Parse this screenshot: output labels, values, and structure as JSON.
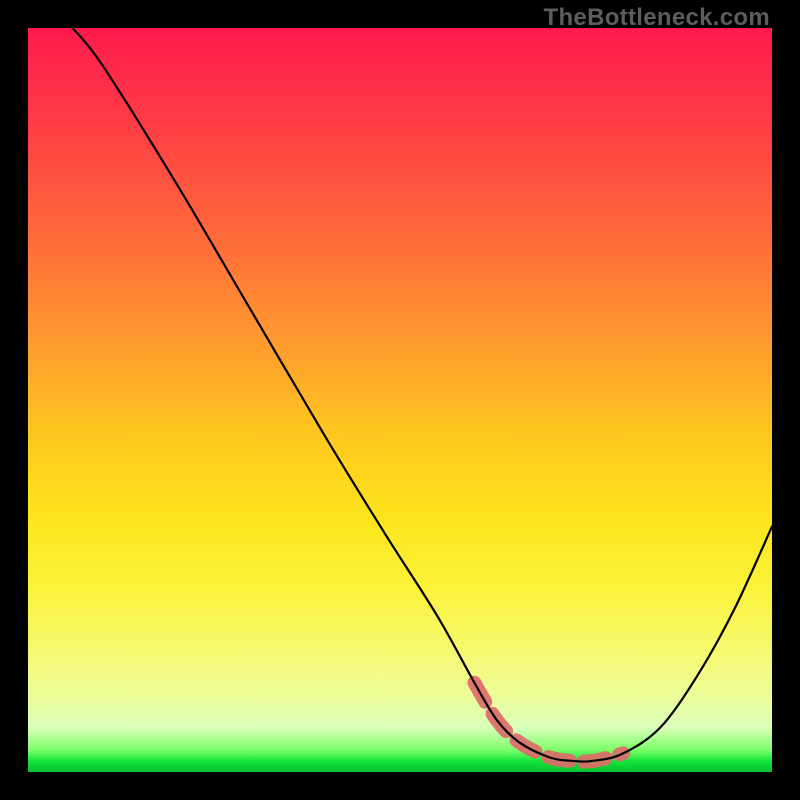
{
  "watermark": {
    "text": "TheBottleneck.com"
  },
  "chart_data": {
    "type": "line",
    "title": "",
    "xlabel": "",
    "ylabel": "",
    "xlim": [
      0,
      100
    ],
    "ylim": [
      0,
      100
    ],
    "grid": false,
    "legend": false,
    "series": [
      {
        "name": "curve",
        "x": [
          6,
          10,
          20,
          30,
          40,
          48,
          55,
          60,
          63,
          66,
          70,
          73,
          76,
          80,
          85,
          90,
          95,
          100
        ],
        "y": [
          100,
          95,
          79,
          62,
          45,
          32,
          21,
          12,
          7,
          4,
          2,
          1.5,
          1.5,
          2.5,
          6,
          13,
          22,
          33
        ]
      }
    ],
    "annotations": {
      "valley_band": {
        "description": "slightly thicker salmon-colored segment along valley bottom",
        "x_range": [
          60,
          81
        ],
        "y_approx": 2
      }
    }
  },
  "colors": {
    "curve_stroke": "#000000",
    "valley_band": "#de6b6b",
    "background_top": "#ff1a4d",
    "background_bottom": "#06c22e",
    "frame": "#000000"
  }
}
